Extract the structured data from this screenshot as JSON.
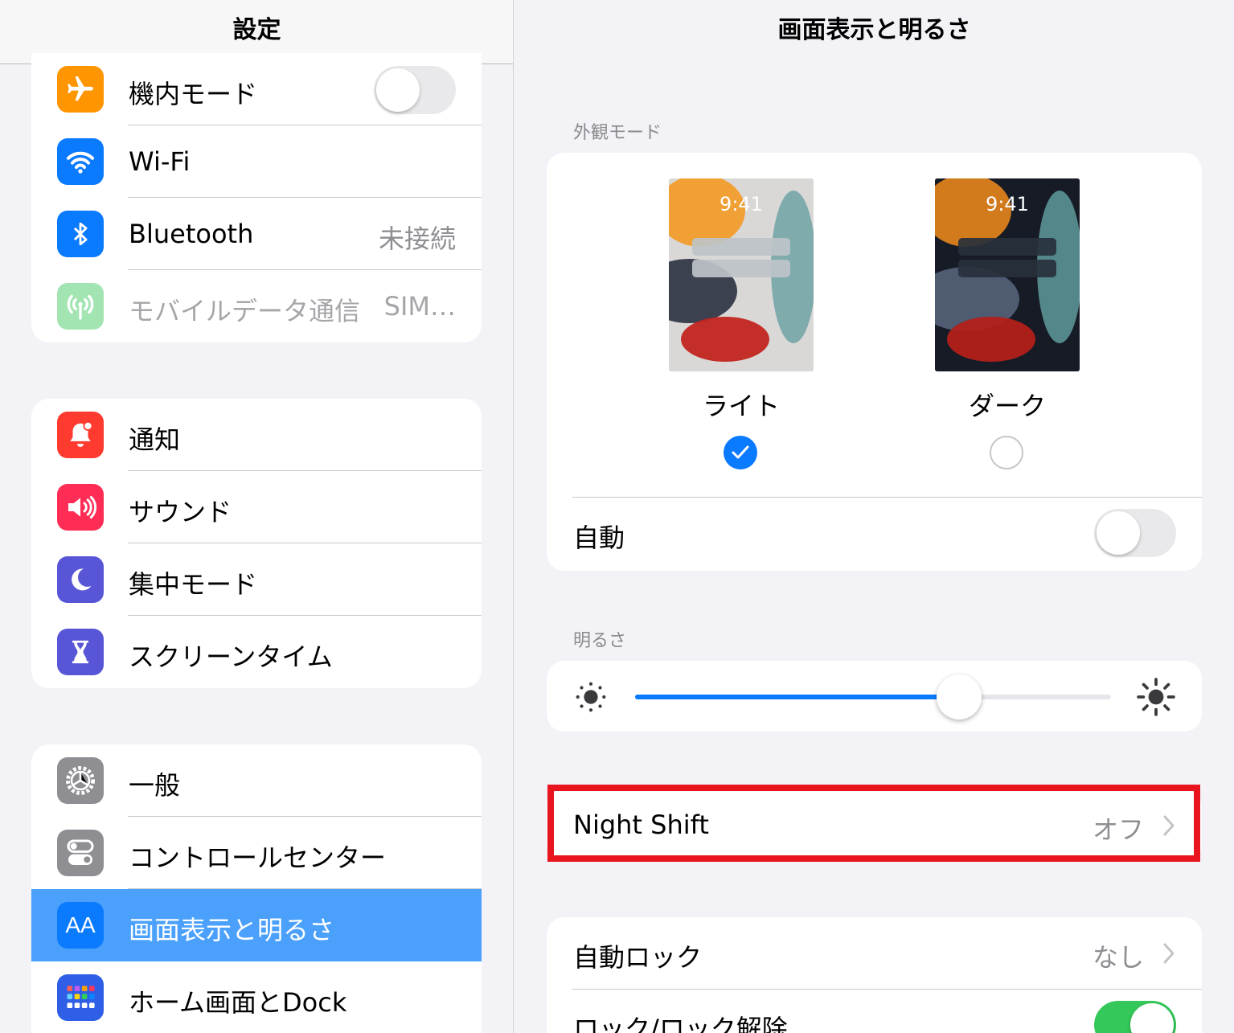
{
  "sidebar": {
    "title": "設定",
    "group1": [
      {
        "label": "機内モード",
        "icon": "airplane-icon"
      },
      {
        "label": "Wi-Fi",
        "value": "",
        "icon": "wifi-icon"
      },
      {
        "label": "Bluetooth",
        "value": "未接続",
        "icon": "bluetooth-icon"
      },
      {
        "label": "モバイルデータ通信",
        "value": "SIM…",
        "icon": "antenna-icon"
      }
    ],
    "group2": [
      {
        "label": "通知",
        "icon": "bell-icon"
      },
      {
        "label": "サウンド",
        "icon": "speaker-icon"
      },
      {
        "label": "集中モード",
        "icon": "moon-icon"
      },
      {
        "label": "スクリーンタイム",
        "icon": "hourglass-icon"
      }
    ],
    "group3": [
      {
        "label": "一般",
        "icon": "gear-icon"
      },
      {
        "label": "コントロールセンター",
        "icon": "switches-icon"
      },
      {
        "label": "画面表示と明るさ",
        "icon": "text-size-icon",
        "icon_text": "AA"
      },
      {
        "label": "ホーム画面とDock",
        "icon": "app-grid-icon"
      }
    ],
    "airplane_mode_on": false
  },
  "detail": {
    "title": "画面表示と明るさ",
    "appearance": {
      "section_label": "外観モード",
      "light": {
        "name": "ライト",
        "time": "9:41",
        "selected": true
      },
      "dark": {
        "name": "ダーク",
        "time": "9:41",
        "selected": false
      },
      "auto_label": "自動",
      "auto_on": false
    },
    "brightness": {
      "section_label": "明るさ",
      "level": 0.68
    },
    "night_shift": {
      "label": "Night Shift",
      "value": "オフ"
    },
    "auto_lock": {
      "label": "自動ロック",
      "value": "なし"
    },
    "lock_unlock": {
      "label": "ロック/ロック解除",
      "on": true
    }
  },
  "colors": {
    "accent": "#0a7aff",
    "selected_row": "#4aa0fb",
    "highlight_box": "#e8141e",
    "toggle_on": "#34c759"
  }
}
